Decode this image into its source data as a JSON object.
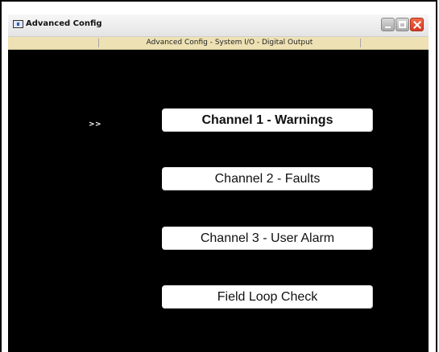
{
  "window": {
    "title": "Advanced Config",
    "icon": "app-window-icon",
    "controls": {
      "minimize_icon": "minimize-icon",
      "maximize_icon": "maximize-icon",
      "close_icon": "close-icon"
    }
  },
  "breadcrumb": {
    "text": "Advanced Config - System I/O - Digital Output"
  },
  "menu": {
    "selection_marker": ">>",
    "items": [
      {
        "label": "Channel 1 - Warnings",
        "selected": true
      },
      {
        "label": "Channel 2 - Faults",
        "selected": false
      },
      {
        "label": "Channel 3 - User Alarm",
        "selected": false
      },
      {
        "label": "Field Loop Check",
        "selected": false
      }
    ]
  },
  "colors": {
    "background": "#000000",
    "breadcrumb_bar": "#eee2b4",
    "button_face": "#ffffff",
    "close_button": "#e2472a"
  }
}
